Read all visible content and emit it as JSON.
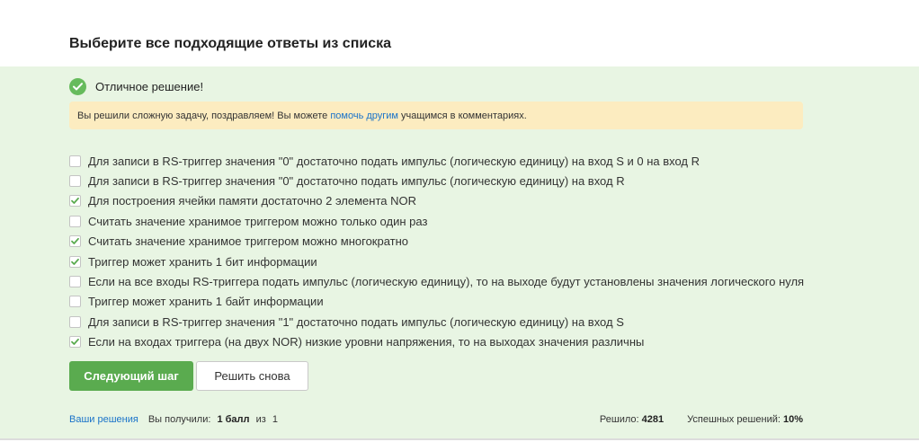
{
  "question": {
    "title": "Выберите все подходящие ответы из списка"
  },
  "status": {
    "icon": "check-circle-icon",
    "text": "Отличное решение!",
    "color": "#66bb5c"
  },
  "notice": {
    "before": "Вы решили сложную задачу, поздравляем! Вы можете ",
    "link": "помочь другим",
    "after": " учащимся в комментариях."
  },
  "options": [
    {
      "label": "Для записи в RS-триггер значения \"0\" достаточно подать импульс (логическую единицу) на вход S и 0 на вход R",
      "checked": false
    },
    {
      "label": "Для записи в RS-триггер значения \"0\" достаточно подать импульс (логическую единицу) на вход R",
      "checked": false
    },
    {
      "label": "Для построения ячейки памяти достаточно 2 элемента NOR",
      "checked": true
    },
    {
      "label": "Считать значение хранимое триггером можно только один раз",
      "checked": false
    },
    {
      "label": "Считать значение хранимое триггером можно многократно",
      "checked": true
    },
    {
      "label": "Триггер может хранить 1 бит информации",
      "checked": true
    },
    {
      "label": "Если на все входы RS-триггера подать импульс (логическую единицу), то на выходе будут установлены значения логического нуля",
      "checked": false
    },
    {
      "label": "Триггер может хранить 1 байт информации",
      "checked": false
    },
    {
      "label": "Для записи в RS-триггер значения \"1\" достаточно подать импульс (логическую единицу) на вход S",
      "checked": false
    },
    {
      "label": "Если на входах триггера (на двух NOR) низкие уровни напряжения, то на выходах значения различны",
      "checked": true
    }
  ],
  "buttons": {
    "next": "Следующий шаг",
    "retry": "Решить снова"
  },
  "footer": {
    "solutions_link": "Ваши решения",
    "received_prefix": "Вы получили: ",
    "received_value": "1 балл",
    "received_mid": " из ",
    "received_total": "1",
    "solved_label": "Решило: ",
    "solved_value": "4281",
    "success_label": "Успешных решений: ",
    "success_value": "10%"
  },
  "colors": {
    "panel_bg": "#e8f5e3",
    "notice_bg": "#fcecc0",
    "primary": "#5aab4f",
    "link": "#1a73c9"
  }
}
